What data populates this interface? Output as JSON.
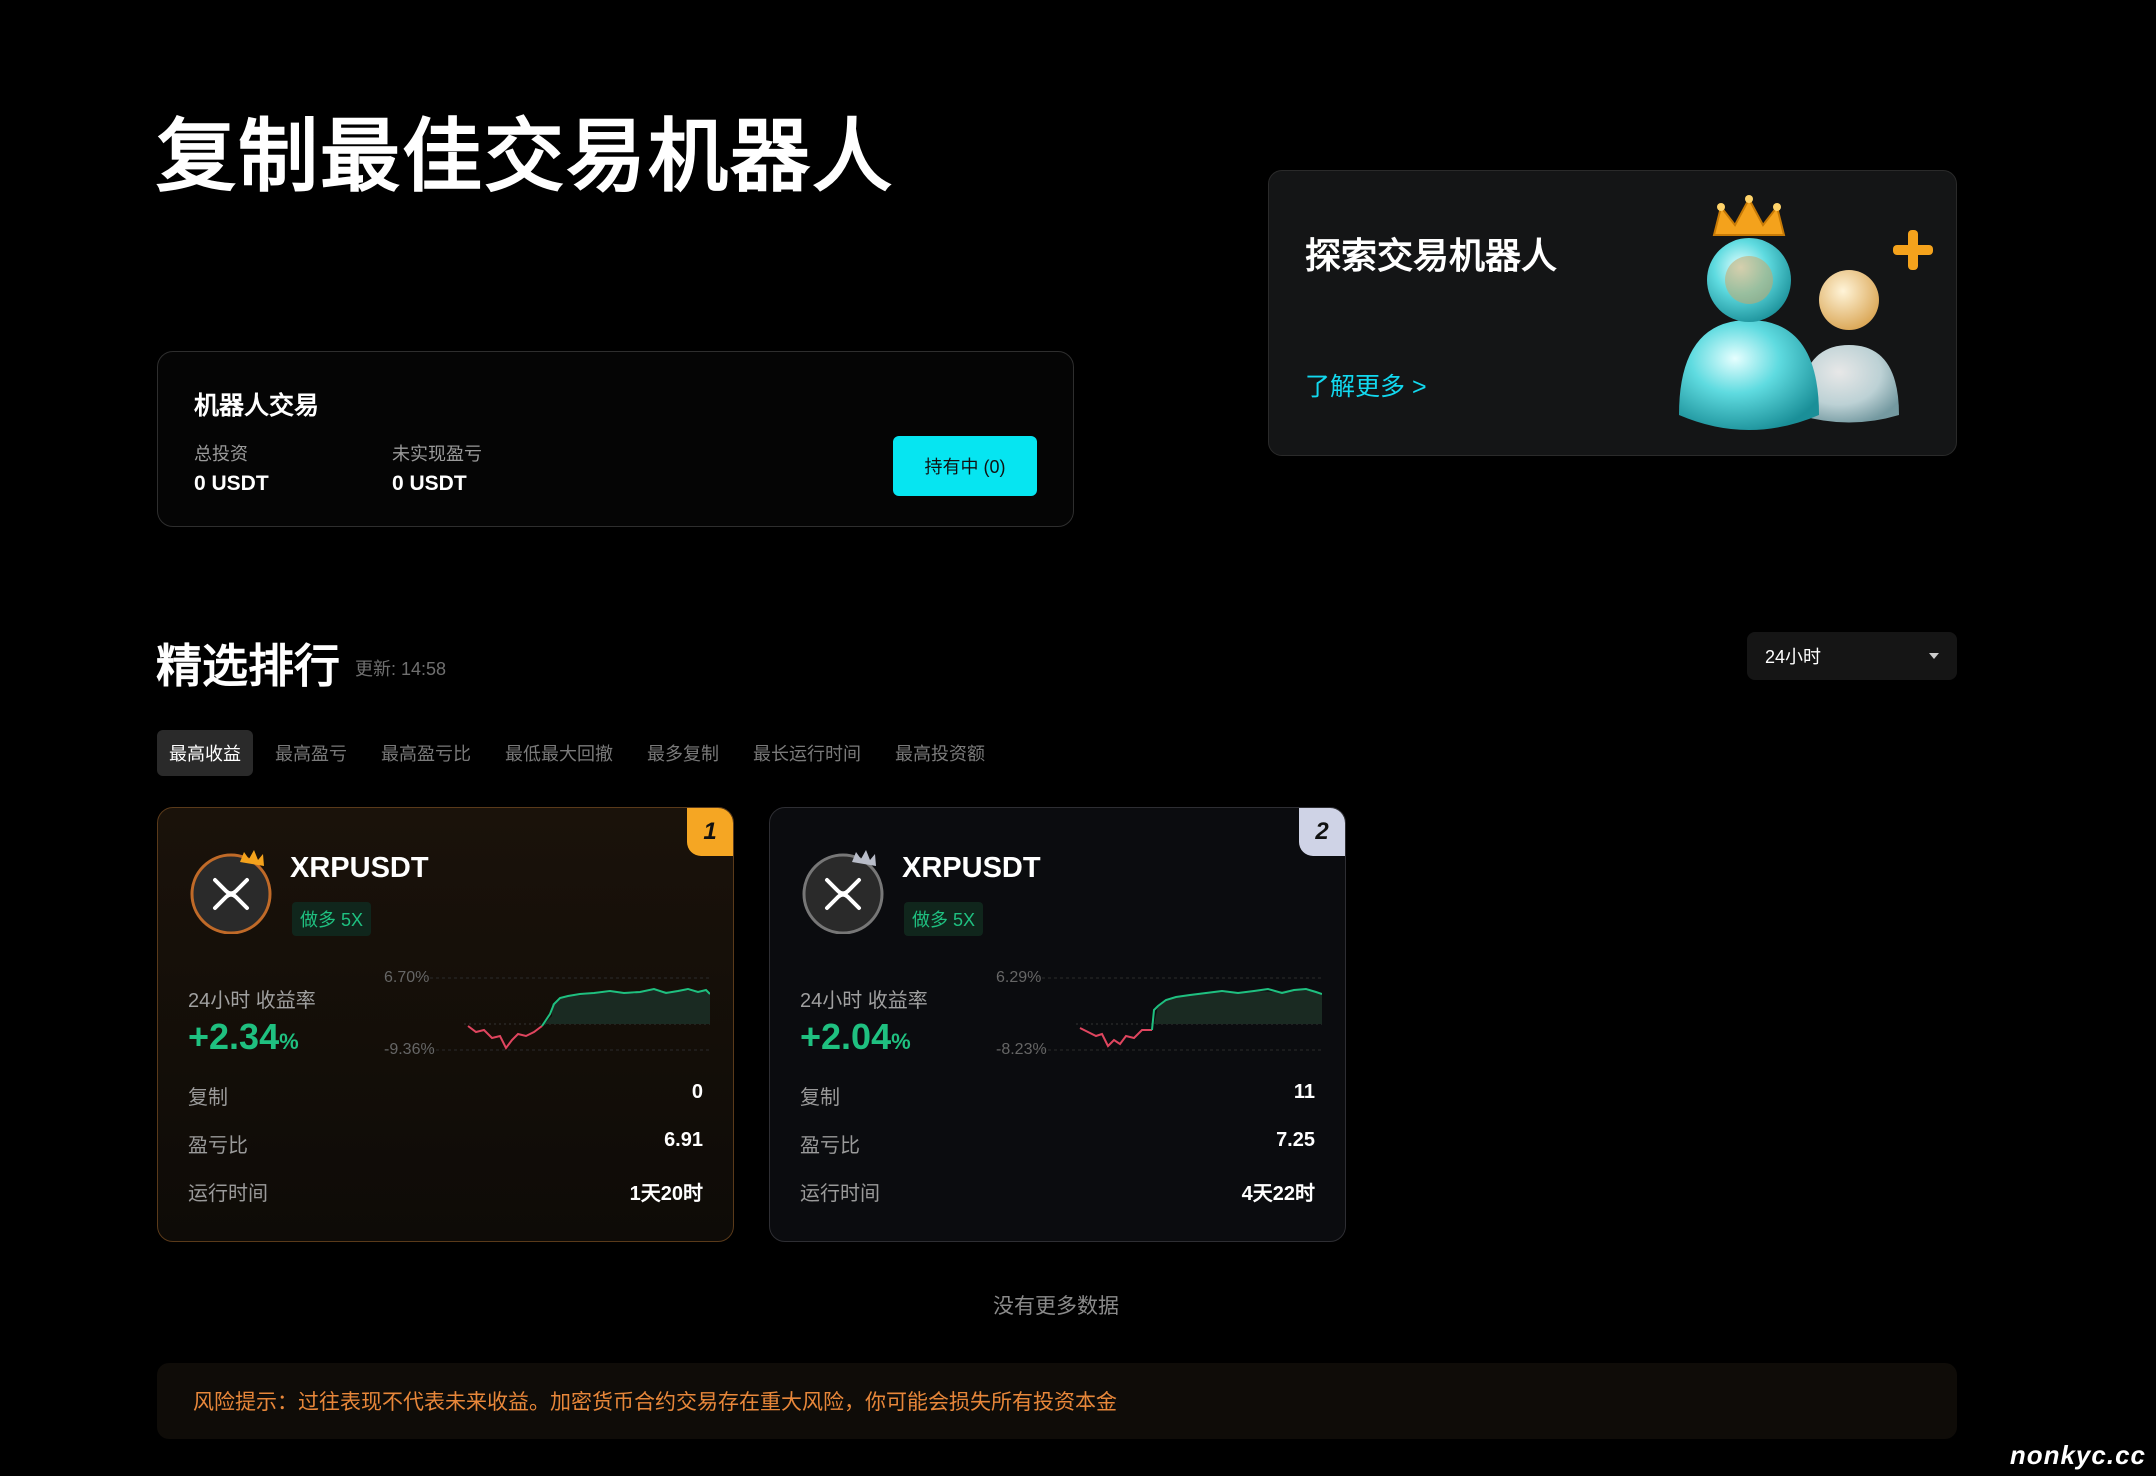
{
  "page": {
    "title": "复制最佳交易机器人"
  },
  "robot_trading": {
    "title": "机器人交易",
    "total_investment_label": "总投资",
    "total_investment_value": "0 USDT",
    "unrealized_pnl_label": "未实现盈亏",
    "unrealized_pnl_value": "0 USDT",
    "holding_button": "持有中 (0)"
  },
  "explore": {
    "title": "探索交易机器人",
    "link": "了解更多 >"
  },
  "ranking": {
    "title": "精选排行",
    "updated": "更新: 14:58",
    "time_filter": "24小时",
    "tabs": [
      "最高收益",
      "最高盈亏",
      "最高盈亏比",
      "最低最大回撤",
      "最多复制",
      "最长运行时间",
      "最高投资额"
    ],
    "active_tab": 0
  },
  "bots": [
    {
      "rank": "1",
      "pair": "XRPUSDT",
      "tag": "做多 5X",
      "yield_label": "24小时 收益率",
      "yield_value": "+2.34",
      "yield_unit": "%",
      "chart_max": "6.70%",
      "chart_min": "-9.36%",
      "copies_label": "复制",
      "copies": "0",
      "pnl_ratio_label": "盈亏比",
      "pnl_ratio": "6.91",
      "runtime_label": "运行时间",
      "runtime": "1天20时"
    },
    {
      "rank": "2",
      "pair": "XRPUSDT",
      "tag": "做多 5X",
      "yield_label": "24小时 收益率",
      "yield_value": "+2.04",
      "yield_unit": "%",
      "chart_max": "6.29%",
      "chart_min": "-8.23%",
      "copies_label": "复制",
      "copies": "11",
      "pnl_ratio_label": "盈亏比",
      "pnl_ratio": "7.25",
      "runtime_label": "运行时间",
      "runtime": "4天22时"
    }
  ],
  "no_more": "没有更多数据",
  "risk_notice": "风险提示：过往表现不代表未来收益。加密货币合约交易存在重大风险，你可能会损失所有投资本金",
  "watermark": "nonkyc.cc",
  "colors": {
    "accent": "#06e5f1",
    "positive": "#1fc080",
    "negative": "#e0455f",
    "warning": "#e8873a",
    "gold": "#f5a623",
    "silver": "#cfd3e6"
  }
}
